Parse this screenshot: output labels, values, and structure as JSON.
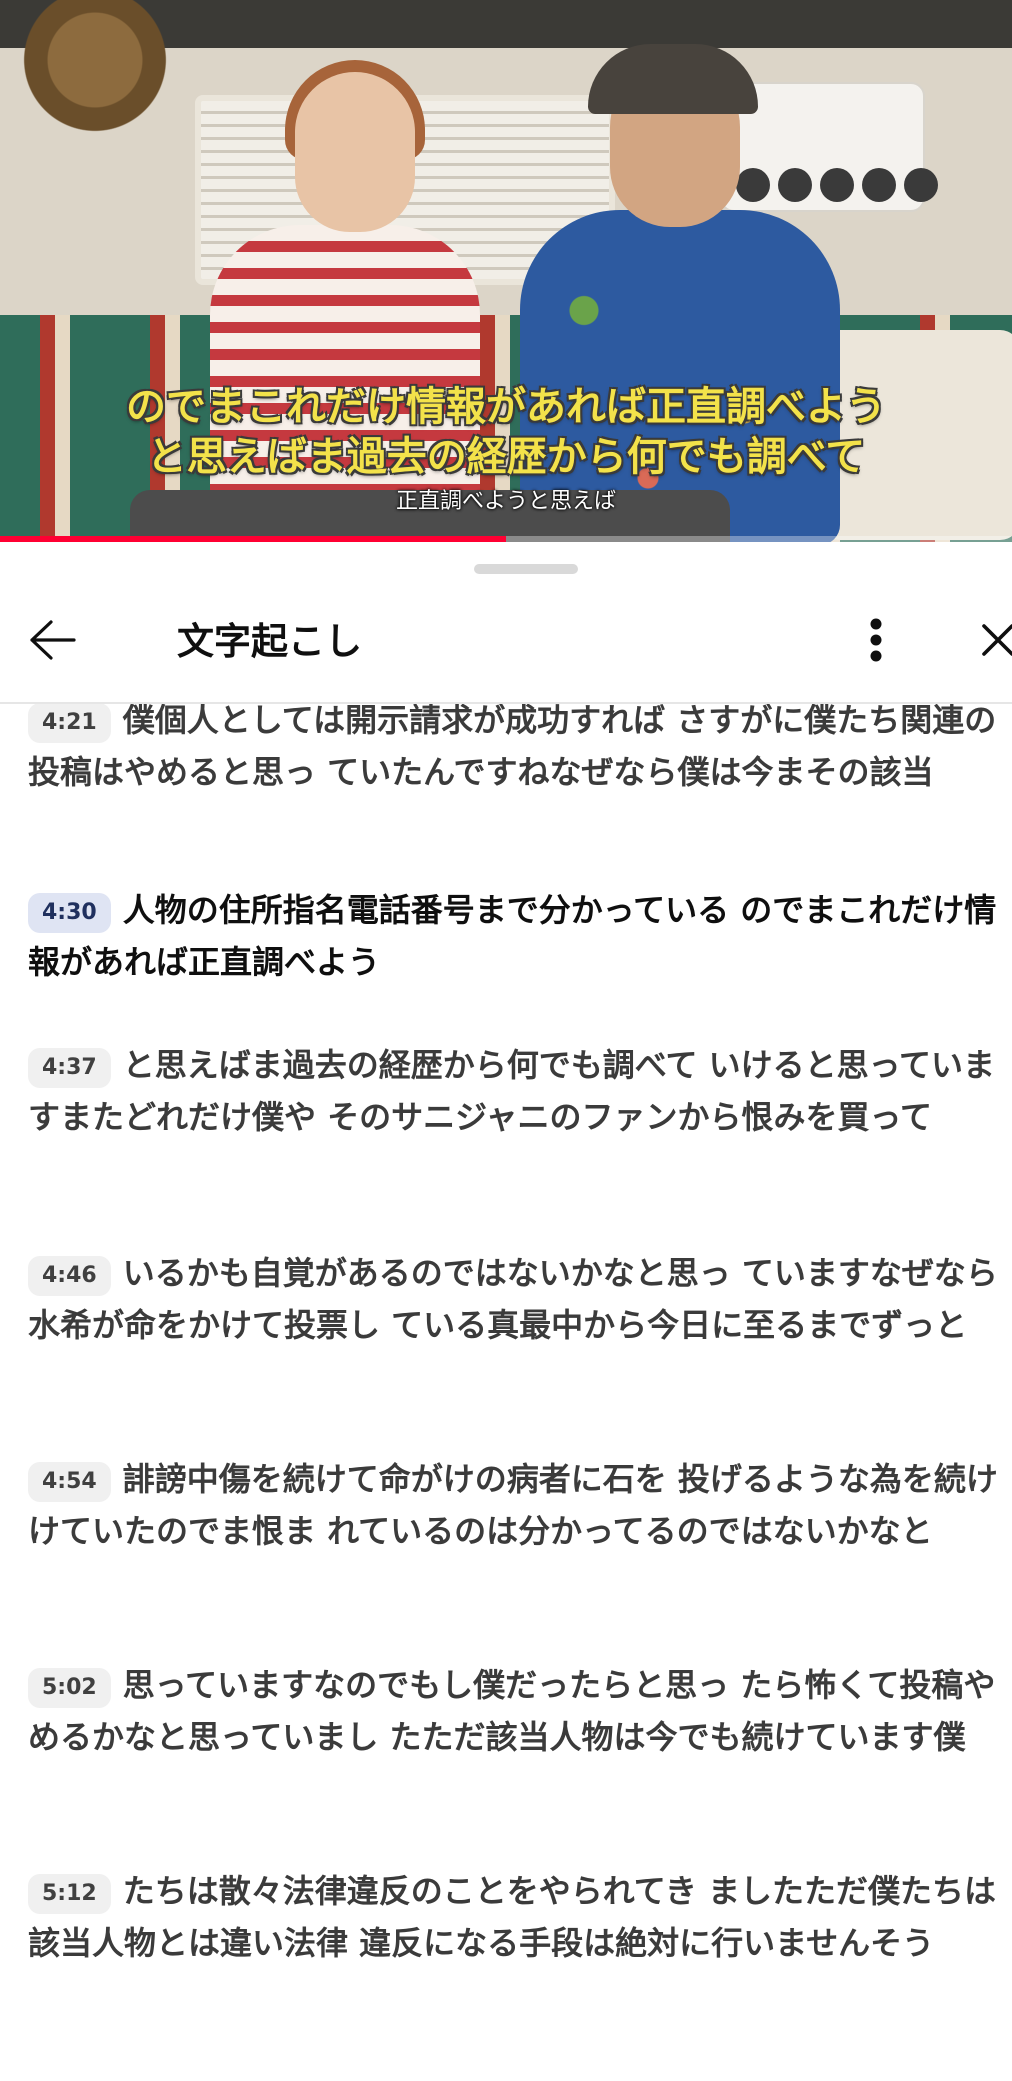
{
  "video": {
    "caption_main_line1": "のでまこれだけ情報があれば正直調べよう",
    "caption_main_line2": "と思えばま過去の経歴から何でも調べて",
    "caption_sub": "正直調べようと思えば",
    "progress_fraction": 0.5
  },
  "sheet": {
    "title": "文字起こし",
    "back_icon": "arrow-left-icon",
    "more_icon": "vertical-dots-icon",
    "close_icon": "close-icon"
  },
  "segments": [
    {
      "time": "4:21",
      "text": "僕個人としては開示請求が成功すれば さすがに僕たち関連の投稿はやめると思っ ていたんですねなぜなら僕は今まその該当",
      "active": false
    },
    {
      "time": "4:30",
      "text": "人物の住所指名電話番号まで分かっている のでまこれだけ情報があれば正直調べよう",
      "active": true
    },
    {
      "time": "4:37",
      "text": "と思えばま過去の経歴から何でも調べて いけると思っていますまたどれだけ僕や そのサニジャニのファンから恨みを買って",
      "active": false
    },
    {
      "time": "4:46",
      "text": "いるかも自覚があるのではないかなと思っ ていますなぜなら水希が命をかけて投票し ている真最中から今日に至るまでずっと",
      "active": false
    },
    {
      "time": "4:54",
      "text": "誹謗中傷を続けて命がけの病者に石を 投げるような為を続けけていたのでま恨ま れているのは分かってるのではないかなと",
      "active": false
    },
    {
      "time": "5:02",
      "text": "思っていますなのでもし僕だったらと思っ たら怖くて投稿やめるかなと思っていまし たただ該当人物は今でも続けています僕",
      "active": false
    },
    {
      "time": "5:12",
      "text": "たちは散々法律違反のことをやられてき ましたただ僕たちは該当人物とは違い法律 違反になる手段は絶対に行いませんそう",
      "active": false
    }
  ],
  "colors": {
    "caption_yellow": "#f3e24a",
    "progress_red": "#ff0033",
    "active_ts_bg": "#dfe4f3"
  }
}
